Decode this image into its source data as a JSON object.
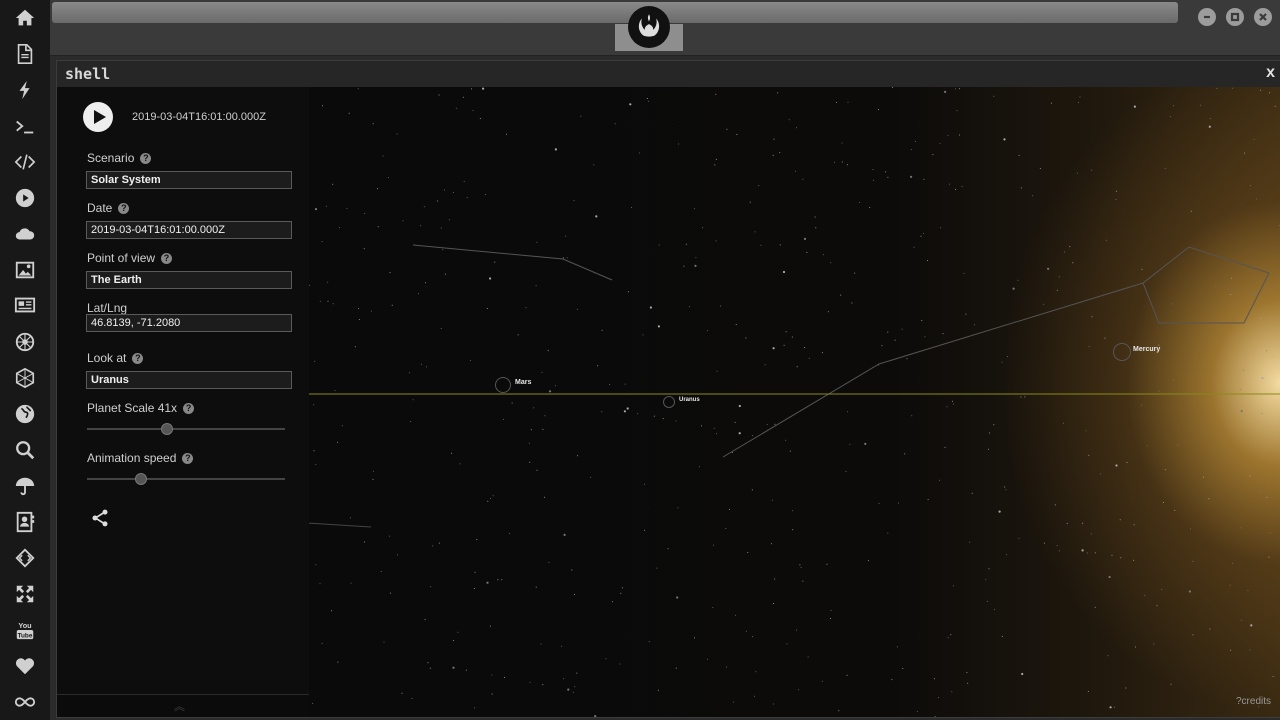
{
  "window": {
    "title": "shell",
    "close_label": "x"
  },
  "sidebar": {
    "icons": [
      "home-icon",
      "document-icon",
      "lightning-icon",
      "terminal-icon",
      "code-icon",
      "play-icon",
      "cloud-icon",
      "image-icon",
      "newspaper-icon",
      "rebel-icon",
      "hexagon-icon",
      "globe-icon",
      "search-icon",
      "umbrella-icon",
      "contacts-icon",
      "diamond-code-icon",
      "fullscreen-icon",
      "youtube-icon",
      "heart-icon",
      "infinity-icon"
    ]
  },
  "panel": {
    "timestamp": "2019-03-04T16:01:00.000Z",
    "scenario_label": "Scenario",
    "scenario_value": "Solar System",
    "date_label": "Date",
    "date_value": "2019-03-04T16:01:00.000Z",
    "pov_label": "Point of view",
    "pov_value": "The Earth",
    "latlng_label": "Lat/Lng",
    "latlng_value": "46.8139, -71.2080",
    "lookat_label": "Look at",
    "lookat_value": "Uranus",
    "planet_scale_label": "Planet Scale 41x",
    "planet_scale_level": 0.4,
    "animation_speed_label": "Animation speed",
    "animation_speed_level": 0.27,
    "help_glyph": "?"
  },
  "space": {
    "planets": [
      {
        "name": "Mars"
      },
      {
        "name": "Uranus"
      },
      {
        "name": "Mercury"
      }
    ],
    "credits": "credits"
  },
  "colors": {
    "ecliptic": "#8a8a1a",
    "sun_glow": "#f0c070"
  }
}
